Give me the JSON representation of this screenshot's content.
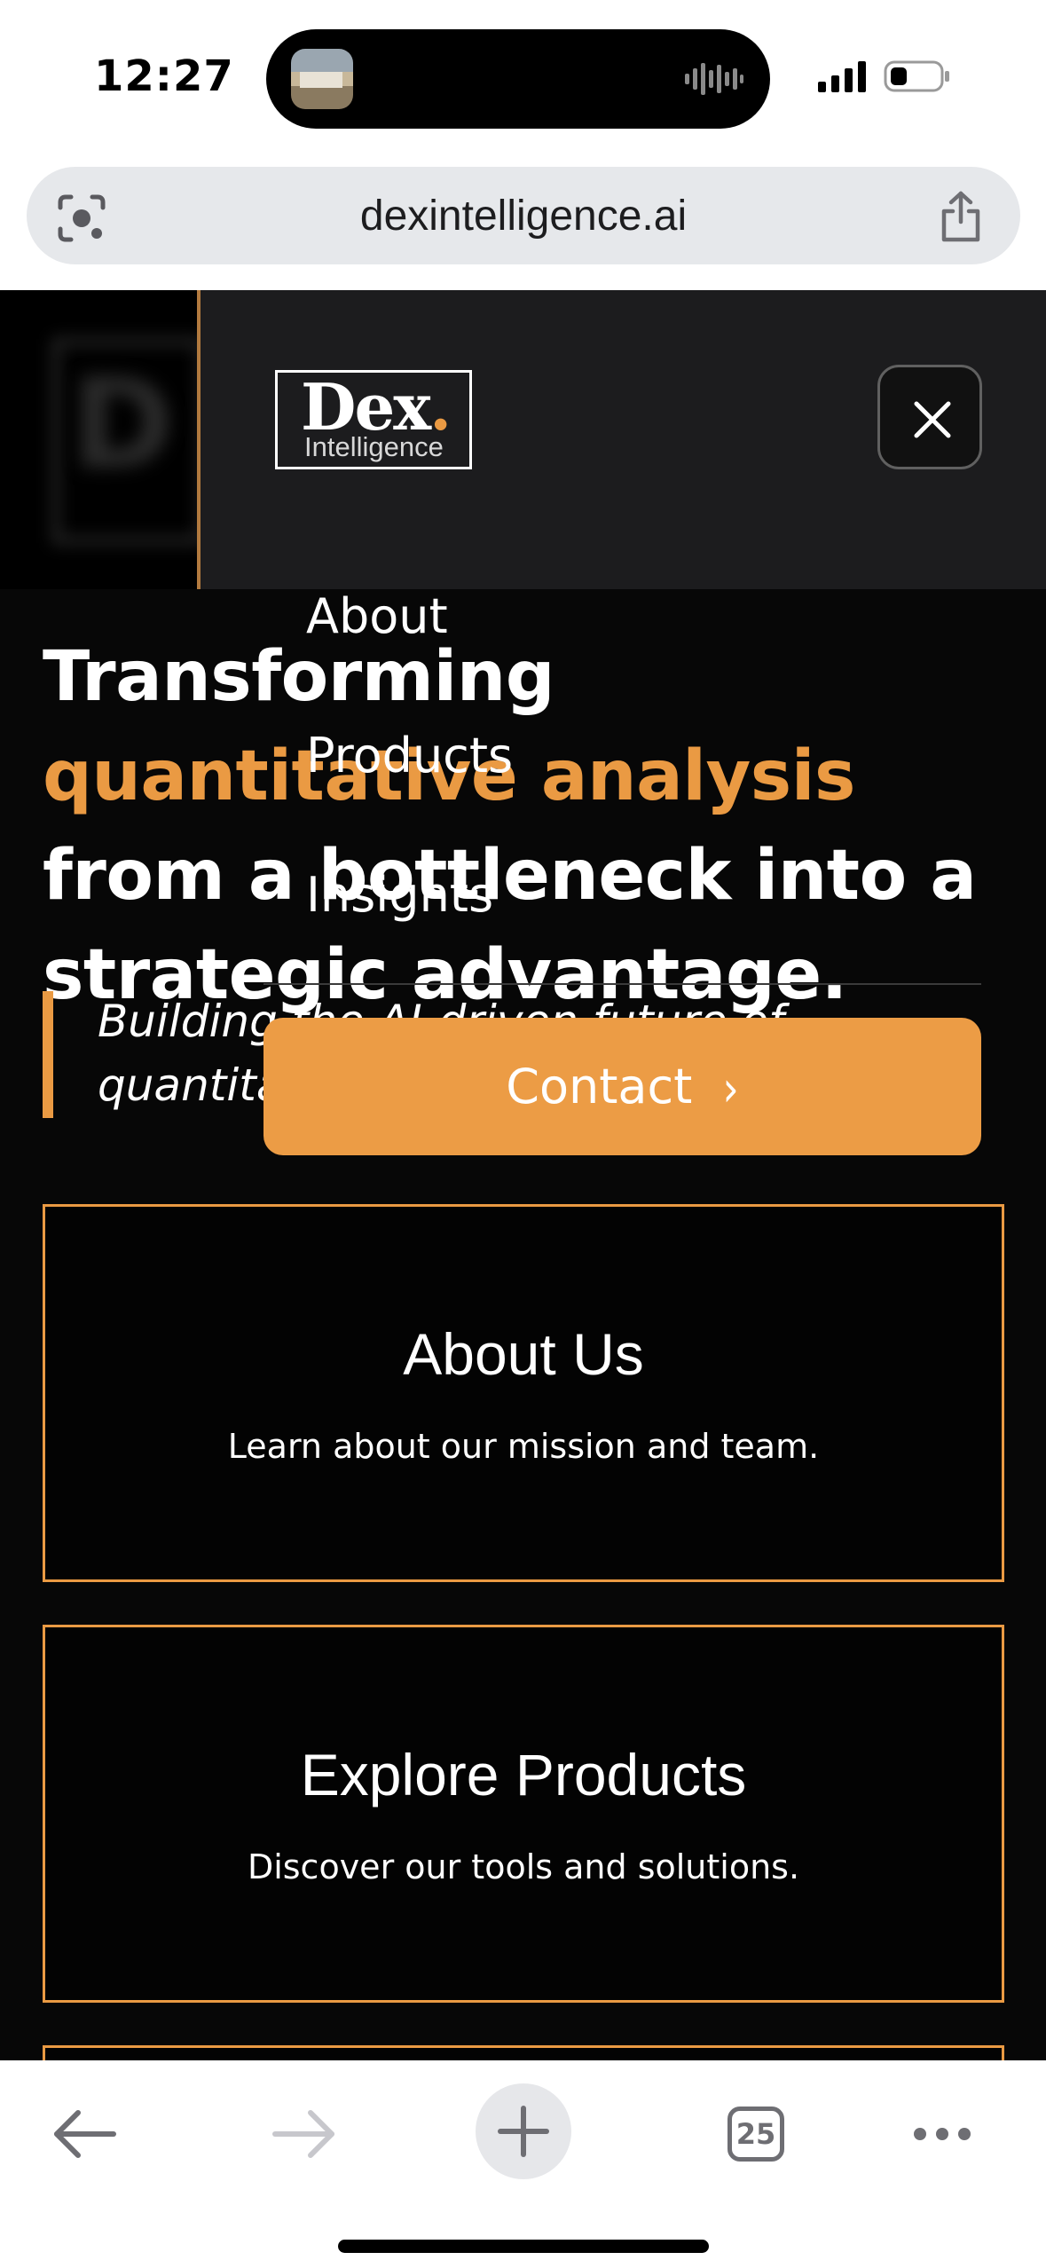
{
  "status_bar": {
    "time": "12:27"
  },
  "browser": {
    "url": "dexintelligence.ai",
    "tab_count": "25"
  },
  "nav_drawer": {
    "logo_word": "Dex",
    "logo_dot": ".",
    "logo_sub": "Intelligence",
    "links": [
      "About",
      "Products",
      "Insights"
    ],
    "contact_label": "Contact",
    "contact_chevron": "›"
  },
  "hero": {
    "title_part1": "Transforming ",
    "title_accent_1": "quantitative",
    "title_accent_2": "analysis",
    "title_part2": " from a bottleneck into a strategic advantage.",
    "tagline": "Building the AI-driven future of quantitative evidence."
  },
  "cards": [
    {
      "title": "About Us",
      "description": "Learn about our mission and team."
    },
    {
      "title": "Explore Products",
      "description": "Discover our tools and solutions."
    }
  ],
  "colors": {
    "accent": "#ea9a43",
    "background": "#070707",
    "drawer": "#1c1c1e"
  }
}
